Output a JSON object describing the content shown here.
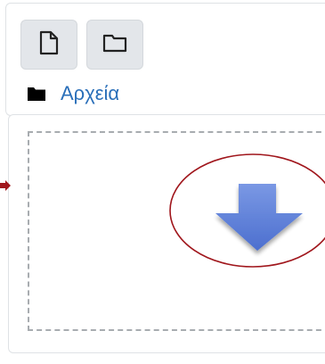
{
  "toolbar": {
    "buttons": [
      {
        "name": "new-file",
        "icon": "file-icon"
      },
      {
        "name": "new-folder",
        "icon": "folder-icon"
      }
    ]
  },
  "path": {
    "icon": "folder-icon",
    "label": "Αρχεία"
  },
  "dropzone": {
    "icon": "down-arrow-icon",
    "arrow_color": "#5b7fd6",
    "highlight_color": "#a0161c"
  }
}
